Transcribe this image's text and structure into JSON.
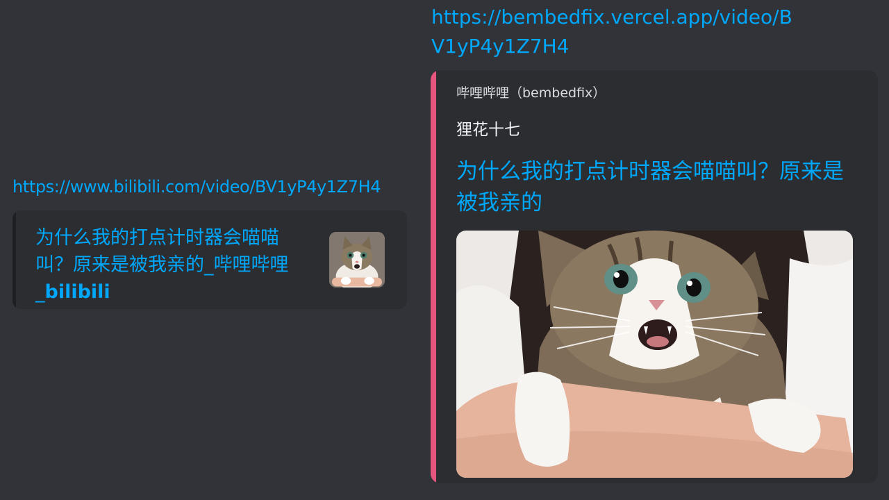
{
  "left_message": {
    "url": "https://www.bilibili.com/video/BV1yP4y1Z7H4",
    "embed": {
      "title_main": "为什么我的打点计时器会喵喵叫？原来是被我亲的_哔哩哔哩_",
      "title_suffix": "bilibili",
      "thumbnail": "cat-thumbnail"
    }
  },
  "right_message": {
    "url": "https://bembedfix.vercel.app/video/BV1yP4y1Z7H4",
    "embed": {
      "provider": "哔哩哔哩（bembedfix）",
      "author": "狸花十七",
      "title": "为什么我的打点计时器会喵喵叫？原来是被我亲的",
      "image": "cat-video-cover",
      "accent_color": "#e5567e"
    }
  },
  "colors": {
    "background": "#313338",
    "embed_background": "#2b2d31",
    "link": "#00a8fc"
  }
}
